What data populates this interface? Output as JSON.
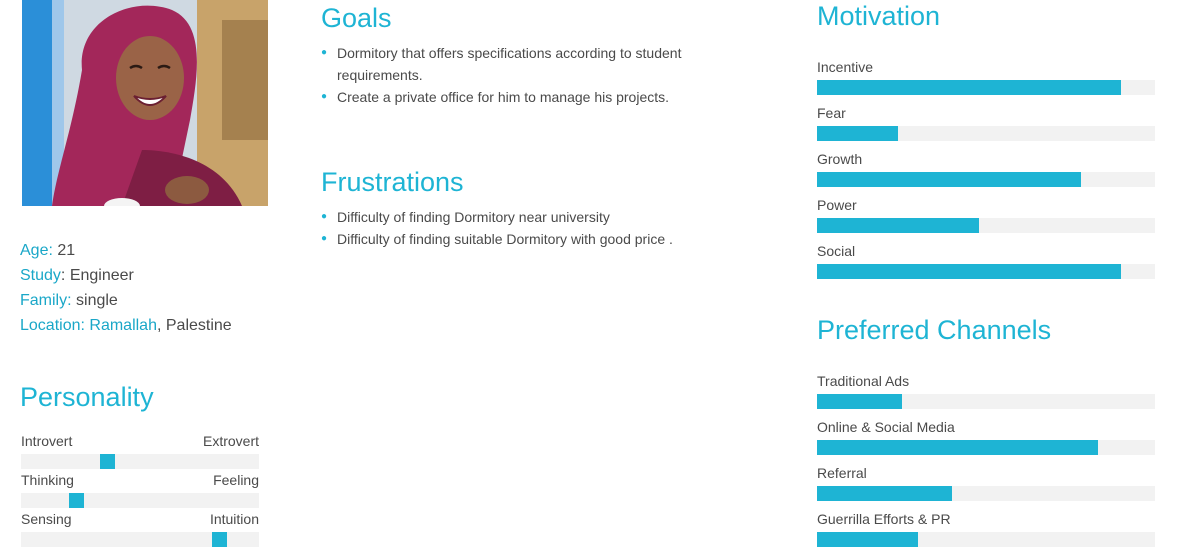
{
  "profile": {
    "age_label": "Age:",
    "age": "21",
    "study_label": "Study",
    "study": "Engineer",
    "family_label": "Family:",
    "family": "single",
    "location_label": "Location:",
    "location_city": "Ramallah",
    "location_country": "Palestine"
  },
  "goals": {
    "title": "Goals",
    "items": [
      "Dormitory that offers specifications according to student requirements.",
      "Create a private office for him to manage his projects."
    ]
  },
  "frustrations": {
    "title": "Frustrations",
    "items": [
      "Difficulty of finding Dormitory near university",
      "Difficulty of finding suitable Dormitory with good price ."
    ]
  },
  "personality": {
    "title": "Personality",
    "traits": [
      {
        "left": "Introvert",
        "right": "Extrovert",
        "level": 0.36
      },
      {
        "left": "Thinking",
        "right": "Feeling",
        "level": 0.23
      },
      {
        "left": "Sensing",
        "right": "Intuition",
        "level": 0.83
      }
    ]
  },
  "motivation": {
    "title": "Motivation",
    "items": [
      {
        "label": "Incentive",
        "level": 0.9
      },
      {
        "label": "Fear",
        "level": 0.24
      },
      {
        "label": "Growth",
        "level": 0.78
      },
      {
        "label": "Power",
        "level": 0.48
      },
      {
        "label": "Social",
        "level": 0.9
      }
    ]
  },
  "channels": {
    "title": "Preferred Channels",
    "items": [
      {
        "label": "Traditional Ads",
        "level": 0.25
      },
      {
        "label": "Online & Social Media",
        "level": 0.83
      },
      {
        "label": "Referral",
        "level": 0.4
      },
      {
        "label": "Guerrilla Efforts & PR",
        "level": 0.3
      }
    ]
  },
  "colors": {
    "accent": "#1eb4d4",
    "track": "#f2f2f2",
    "text": "#4a4a4a"
  }
}
